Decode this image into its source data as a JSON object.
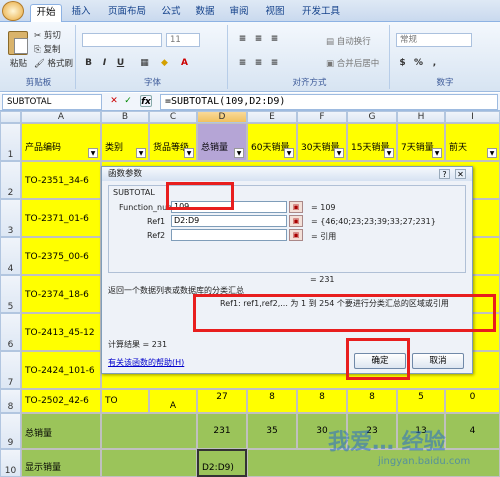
{
  "ribbon": {
    "tabs": [
      "开始",
      "插入",
      "页面布局",
      "公式",
      "数据",
      "审阅",
      "视图",
      "开发工具"
    ],
    "active_tab": "开始",
    "clipboard": {
      "paste": "粘贴",
      "cut": "剪切",
      "copy": "复制",
      "format_painter": "格式刷",
      "label": "剪贴板"
    },
    "font": {
      "size": "11",
      "bold": "B",
      "italic": "I",
      "underline": "U",
      "label": "字体"
    },
    "alignment": {
      "wrap": "自动换行",
      "merge": "合并后居中",
      "label": "对齐方式"
    },
    "number": {
      "format": "常规",
      "percent": "%",
      "comma": ",",
      "label": "数字"
    }
  },
  "formula_bar": {
    "name_box": "SUBTOTAL",
    "cancel": "✕",
    "enter": "✓",
    "fx": "fx",
    "formula": "=SUBTOTAL(109,D2:D9)"
  },
  "sheet": {
    "columns": [
      "A",
      "B",
      "C",
      "D",
      "E",
      "F",
      "G",
      "H",
      "I"
    ],
    "selected_column": "D",
    "rows": [
      "1",
      "2",
      "3",
      "4",
      "5",
      "6",
      "7",
      "8",
      "9",
      "10"
    ],
    "headers": [
      "产品编码",
      "类别",
      "货品等级",
      "总销量",
      "60天销量",
      "30天销量",
      "15天销量",
      "7天销量",
      "前天"
    ],
    "product_codes": [
      "TO-2351_34-6",
      "TO-2371_01-6",
      "TO-2375_00-6",
      "TO-2374_18-6",
      "TO-2413_45-12",
      "TO-2424_101-6",
      "TO-2502_42-6"
    ],
    "row8": {
      "b": "TO",
      "c": "A",
      "d": "27",
      "e": "8",
      "f": "8",
      "g": "8",
      "h": "5",
      "i": "0"
    },
    "row9": {
      "a": "总销量",
      "d": "231",
      "e": "35",
      "f": "30",
      "g": "23",
      "h": "13",
      "i": "4"
    },
    "row10": {
      "a": "显示销量",
      "d": "D2:D9)"
    }
  },
  "dialog": {
    "title": "函数参数",
    "help": "?",
    "close": "✕",
    "func_name": "SUBTOTAL",
    "arg1_label": "Function_num",
    "arg1_value": "109",
    "arg1_result": "= 109",
    "arg2_label": "Ref1",
    "arg2_value": "D2:D9",
    "arg2_result": "= {46;40;23;23;39;33;27;231}",
    "arg3_label": "Ref2",
    "arg3_result": "= 引用",
    "total_result": "= 231",
    "description": "返回一个数据列表或数据库的分类汇总",
    "arg_help": "Ref1:  ref1,ref2,...  为 1 到 254 个要进行分类汇总的区域或引用",
    "calc_result_label": "计算结果 = 231",
    "help_link": "有关该函数的帮助(H)",
    "ok": "确定",
    "cancel": "取消"
  },
  "watermark": {
    "text": "我爱… 经验",
    "url": "jingyan.baidu.com"
  }
}
